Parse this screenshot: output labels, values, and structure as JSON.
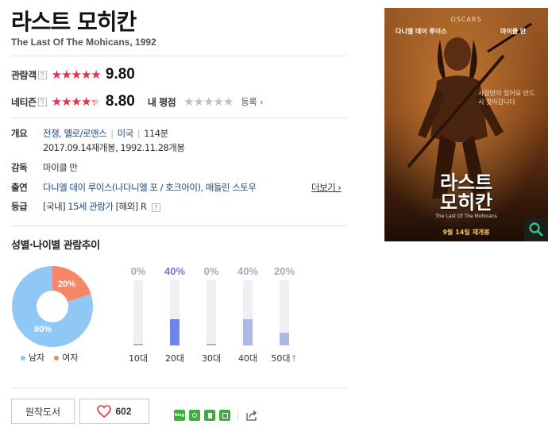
{
  "movie": {
    "title": "라스트 모히칸",
    "original_title": "The Last Of The Mohicans, 1992"
  },
  "ratings": {
    "audience": {
      "label": "관람객",
      "help": "?",
      "score": "9.80",
      "fill_fraction": 0.98
    },
    "netizen": {
      "label": "네티즌",
      "help": "?",
      "score": "8.80",
      "fill_fraction": 0.88
    },
    "mine": {
      "label": "내 평점",
      "stars": "★★★★★",
      "register": "등록 ›"
    },
    "star_glyphs": "★★★★★",
    "star_color": "#e3334b"
  },
  "overview": {
    "label": "개요",
    "genre": "전쟁, 멜로/로맨스",
    "country": "미국",
    "runtime": "114분",
    "release": "2017.09.14재개봉, 1992.11.28개봉"
  },
  "director": {
    "label": "감독",
    "name": "마이클 만"
  },
  "cast": {
    "label": "출연",
    "text": "다니엘 데이 루이스(나다니엘 포 / 호크아이), 매들린 스토우",
    "more": "더보기"
  },
  "grade": {
    "label": "등급",
    "domestic_tag": "[국내]",
    "domestic": "15세 관람가",
    "foreign_tag": "[해외]",
    "foreign": "R",
    "help": "?"
  },
  "poster": {
    "top_small": "다니엘 데이 루이스",
    "director_credit": "마이클 만",
    "title_line1": "라스트",
    "title_line2": "모히칸",
    "tagline": "사랑만이 있어요 반드시 찾아갑니다",
    "subtitle": "The Last Of The Mohicans",
    "date": "9월 14일 재개봉",
    "zoom_icon": "magnifier-icon"
  },
  "trend": {
    "title": "성별·나이별 관람추이",
    "gender": {
      "male_pct": "80%",
      "female_pct": "20%",
      "male_value": 80,
      "female_value": 20,
      "male_label": "남자",
      "female_label": "여자",
      "male_color": "#8fc8f5",
      "female_color": "#f78569"
    },
    "ages": [
      {
        "label": "10대",
        "pct": "0%",
        "value": 0,
        "color": "#aab5c9",
        "pct_color": "#a4acba"
      },
      {
        "label": "20대",
        "pct": "40%",
        "value": 40,
        "color": "#6f86e8",
        "pct_color": "#6f79d6"
      },
      {
        "label": "30대",
        "pct": "0%",
        "value": 0,
        "color": "#aab5c9",
        "pct_color": "#a4acba"
      },
      {
        "label": "40대",
        "pct": "40%",
        "value": 40,
        "color": "#aeb9e3",
        "pct_color": "#a4acba"
      },
      {
        "label": "50대",
        "pct": "20%",
        "value": 20,
        "color": "#aeb9e3",
        "pct_color": "#a4acba",
        "suffix": "↑"
      }
    ]
  },
  "actions": {
    "source_book": "원작도서",
    "likes": "602"
  }
}
